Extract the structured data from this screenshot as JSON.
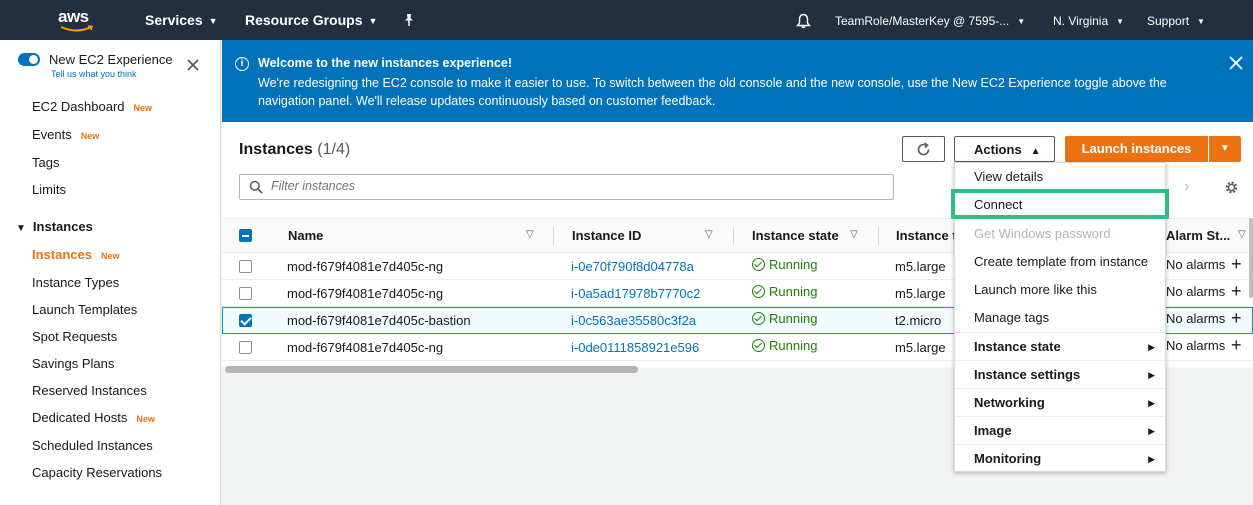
{
  "nav": {
    "logo_text": "aws",
    "services": "Services",
    "resource_groups": "Resource Groups",
    "account": "TeamRole/MasterKey @ 7595-...",
    "region": "N. Virginia",
    "support": "Support"
  },
  "sidebar": {
    "experience_title": "New EC2 Experience",
    "experience_sub": "Tell us what you think",
    "new_badge": "New",
    "items_top": [
      {
        "label": "EC2 Dashboard",
        "badge": "New"
      },
      {
        "label": "Events",
        "badge": "New"
      },
      {
        "label": "Tags",
        "badge": ""
      },
      {
        "label": "Limits",
        "badge": ""
      }
    ],
    "section": "Instances",
    "items_instances": [
      {
        "label": "Instances",
        "badge": "New"
      },
      {
        "label": "Instance Types",
        "badge": ""
      },
      {
        "label": "Launch Templates",
        "badge": ""
      },
      {
        "label": "Spot Requests",
        "badge": ""
      },
      {
        "label": "Savings Plans",
        "badge": ""
      },
      {
        "label": "Reserved Instances",
        "badge": ""
      },
      {
        "label": "Dedicated Hosts",
        "badge": "New"
      },
      {
        "label": "Scheduled Instances",
        "badge": ""
      },
      {
        "label": "Capacity Reservations",
        "badge": ""
      }
    ]
  },
  "banner": {
    "title": "Welcome to the new instances experience!",
    "text": "We're redesigning the EC2 console to make it easier to use. To switch between the old console and the new console, use the New EC2 Experience toggle above the navigation panel. We'll release updates continuously based on customer feedback."
  },
  "instances": {
    "title": "Instances",
    "count": "(1/4)",
    "actions_label": "Actions",
    "launch_label": "Launch instances",
    "filter_placeholder": "Filter instances",
    "columns": [
      "Name",
      "Instance ID",
      "Instance state",
      "Instance t",
      "Alarm St..."
    ],
    "rows": [
      {
        "name": "mod-f679f4081e7d405c-ng",
        "id": "i-0e70f790f8d04778a",
        "state": "Running",
        "type": "m5.large",
        "alarm": "No alarms",
        "selected": false
      },
      {
        "name": "mod-f679f4081e7d405c-ng",
        "id": "i-0a5ad17978b7770c2",
        "state": "Running",
        "type": "m5.large",
        "alarm": "No alarms",
        "selected": false
      },
      {
        "name": "mod-f679f4081e7d405c-bastion",
        "id": "i-0c563ae35580c3f2a",
        "state": "Running",
        "type": "t2.micro",
        "alarm": "No alarms",
        "selected": true
      },
      {
        "name": "mod-f679f4081e7d405c-ng",
        "id": "i-0de0111858921e596",
        "state": "Running",
        "type": "m5.large",
        "alarm": "No alarms",
        "selected": false
      }
    ]
  },
  "actions_menu": [
    {
      "label": "View details",
      "type": "item"
    },
    {
      "label": "Connect",
      "type": "item",
      "highlighted": true
    },
    {
      "label": "Get Windows password",
      "type": "disabled"
    },
    {
      "label": "Create template from instance",
      "type": "item"
    },
    {
      "label": "Launch more like this",
      "type": "item"
    },
    {
      "label": "Manage tags",
      "type": "item"
    },
    {
      "label": "Instance state",
      "type": "group"
    },
    {
      "label": "Instance settings",
      "type": "group"
    },
    {
      "label": "Networking",
      "type": "group"
    },
    {
      "label": "Image",
      "type": "group"
    },
    {
      "label": "Monitoring",
      "type": "group"
    }
  ],
  "colors": {
    "nav_bg": "#232f3e",
    "banner_bg": "#0073bb",
    "accent_orange": "#ec7211",
    "running_green": "#1d8102",
    "highlight_green": "#2ebf80"
  }
}
